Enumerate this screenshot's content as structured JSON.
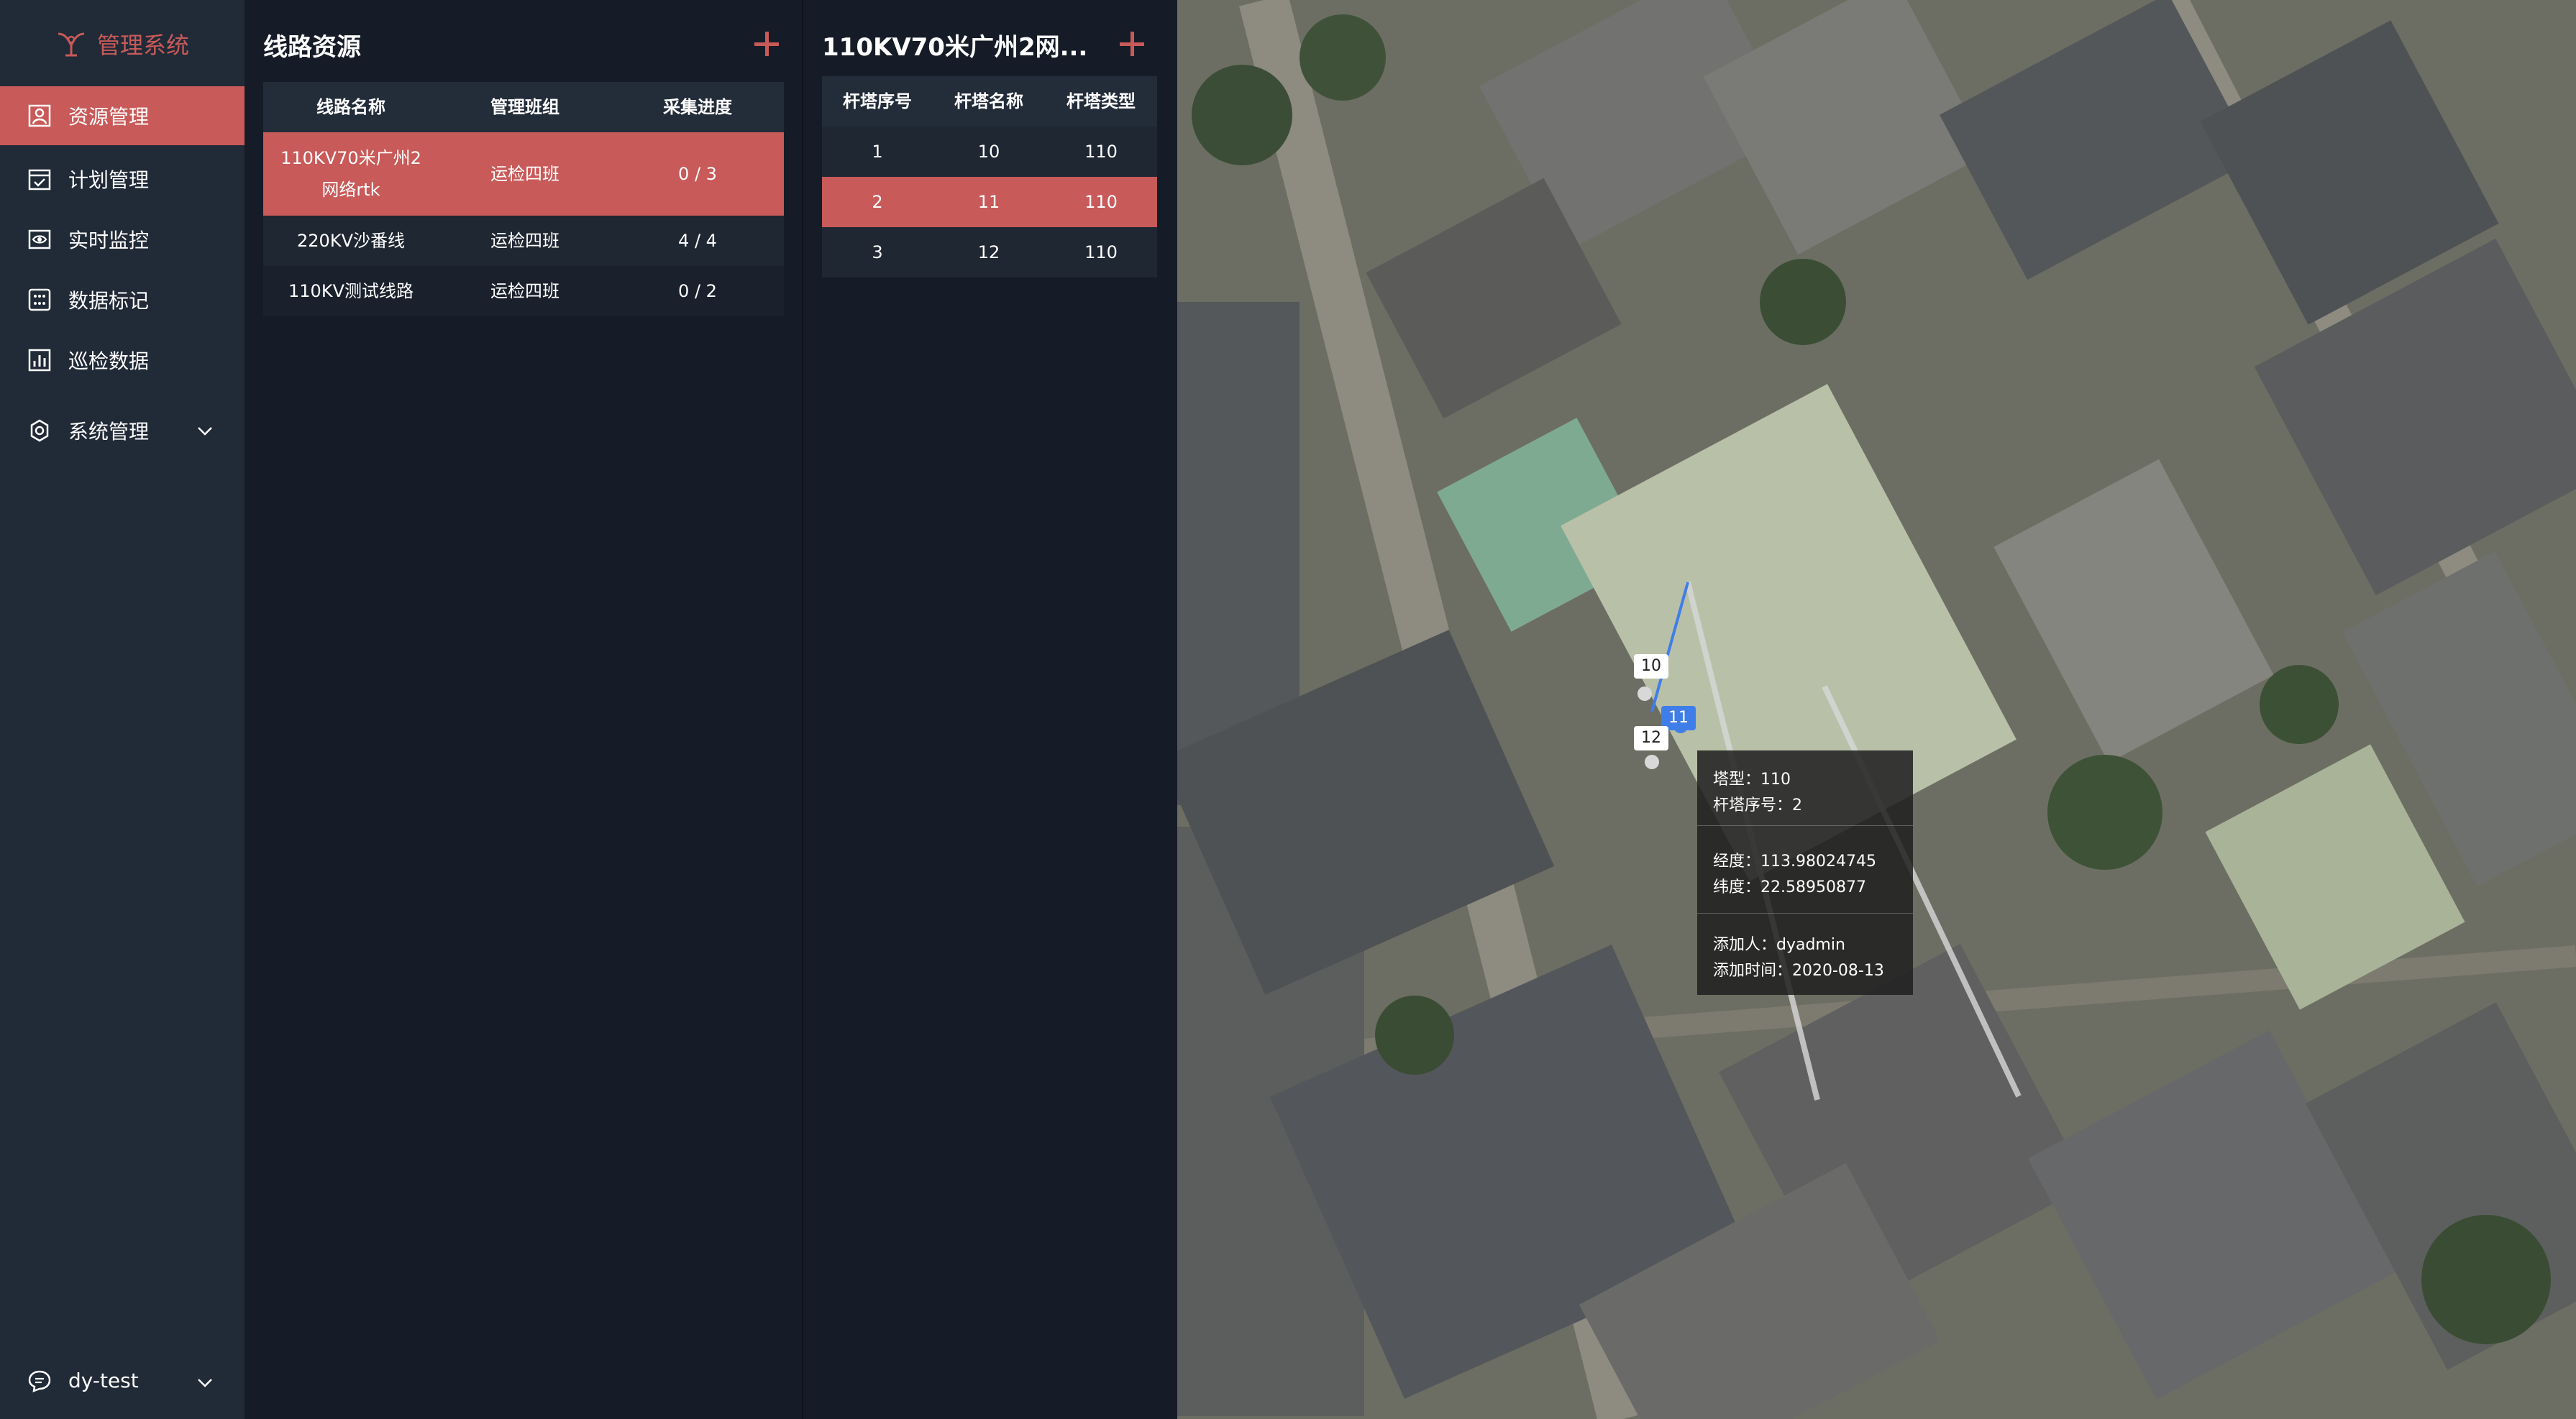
{
  "app": {
    "title": "管理系统",
    "brand_color": "#c85a59"
  },
  "sidebar": {
    "items": [
      {
        "label": "资源管理",
        "icon": "resource-icon"
      },
      {
        "label": "计划管理",
        "icon": "calendar-check-icon"
      },
      {
        "label": "实时监控",
        "icon": "eye-monitor-icon"
      },
      {
        "label": "数据标记",
        "icon": "grid-mark-icon"
      },
      {
        "label": "巡检数据",
        "icon": "bar-chart-icon"
      },
      {
        "label": "系统管理",
        "icon": "gear-icon"
      }
    ],
    "user": "dy-test"
  },
  "lines_panel": {
    "title": "线路资源",
    "columns": [
      "线路名称",
      "管理班组",
      "采集进度"
    ],
    "rows": [
      {
        "name_l1": "110KV70米广州2",
        "name_l2": "网络rtk",
        "team": "运检四班",
        "progress": "0 / 3"
      },
      {
        "name": "220KV沙番线",
        "team": "运检四班",
        "progress": "4 / 4"
      },
      {
        "name": "110KV测试线路",
        "team": "运检四班",
        "progress": "0 / 2"
      }
    ]
  },
  "towers_panel": {
    "title": "110KV70米广州2网...",
    "columns": [
      "杆塔序号",
      "杆塔名称",
      "杆塔类型"
    ],
    "rows": [
      {
        "seq": "1",
        "name": "10",
        "type": "110"
      },
      {
        "seq": "2",
        "name": "11",
        "type": "110"
      },
      {
        "seq": "3",
        "name": "12",
        "type": "110"
      }
    ]
  },
  "map": {
    "tower_labels": [
      "10",
      "11",
      "12"
    ],
    "tooltip": {
      "type": "塔型：110",
      "seq": "杆塔序号：2",
      "lng": "经度：113.98024745",
      "lat": "纬度：22.58950877",
      "adder": "添加人：dyadmin",
      "time": "添加时间：2020-08-13"
    }
  }
}
